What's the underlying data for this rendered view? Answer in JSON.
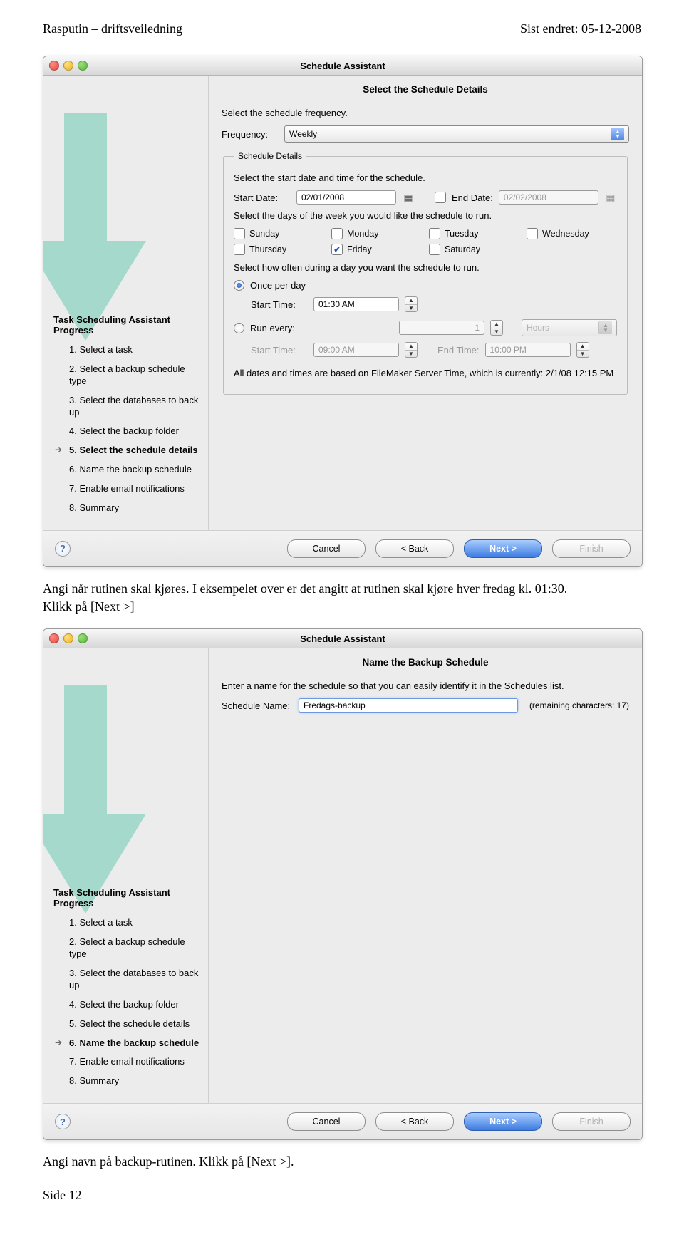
{
  "doc": {
    "header_left": "Rasputin – driftsveiledning",
    "header_right": "Sist endret: 05-12-2008",
    "para1": "Angi når rutinen skal kjøres. I eksempelet over er det angitt at rutinen skal kjøre hver fredag kl. 01:30.",
    "para1b": "Klikk på [Next >]",
    "para2": "Angi navn på backup-rutinen. Klikk på [Next >].",
    "footer": "Side 12"
  },
  "shared": {
    "window_title": "Schedule Assistant",
    "sidebar_title": "Task Scheduling Assistant Progress",
    "steps": [
      "1. Select a task",
      "2. Select a backup schedule type",
      "3. Select the databases to back up",
      "4. Select the backup folder",
      "5. Select the schedule details",
      "6. Name the backup schedule",
      "7. Enable email notifications",
      "8. Summary"
    ],
    "buttons": {
      "cancel": "Cancel",
      "back": "< Back",
      "next": "Next >",
      "finish": "Finish"
    }
  },
  "win1": {
    "heading": "Select the Schedule Details",
    "freq_instr": "Select the schedule frequency.",
    "freq_label": "Frequency:",
    "freq_value": "Weekly",
    "details_legend": "Schedule Details",
    "start_instr": "Select the start date and time for the schedule.",
    "start_label": "Start Date:",
    "start_value": "02/01/2008",
    "end_label": "End Date:",
    "end_value": "02/02/2008",
    "days_instr": "Select the days of the week you would like the schedule to run.",
    "days": [
      "Sunday",
      "Monday",
      "Tuesday",
      "Wednesday",
      "Thursday",
      "Friday",
      "Saturday"
    ],
    "freq2_instr": "Select how often during a day you want the schedule to run.",
    "once_label": "Once per day",
    "starttime_label": "Start Time:",
    "starttime_value": "01:30 AM",
    "runevery_label": "Run every:",
    "runevery_value": "1",
    "runevery_unit": "Hours",
    "range_start_label": "Start Time:",
    "range_start_value": "09:00 AM",
    "range_end_label": "End Time:",
    "range_end_value": "10:00 PM",
    "footnote": "All dates and times are based on FileMaker Server Time, which is currently: 2/1/08 12:15 PM"
  },
  "win2": {
    "heading": "Name the Backup Schedule",
    "instr": "Enter a name for the schedule so that you can easily identify it in the Schedules list.",
    "name_label": "Schedule Name:",
    "name_value": "Fredags-backup",
    "remaining": "(remaining characters:  17)"
  }
}
